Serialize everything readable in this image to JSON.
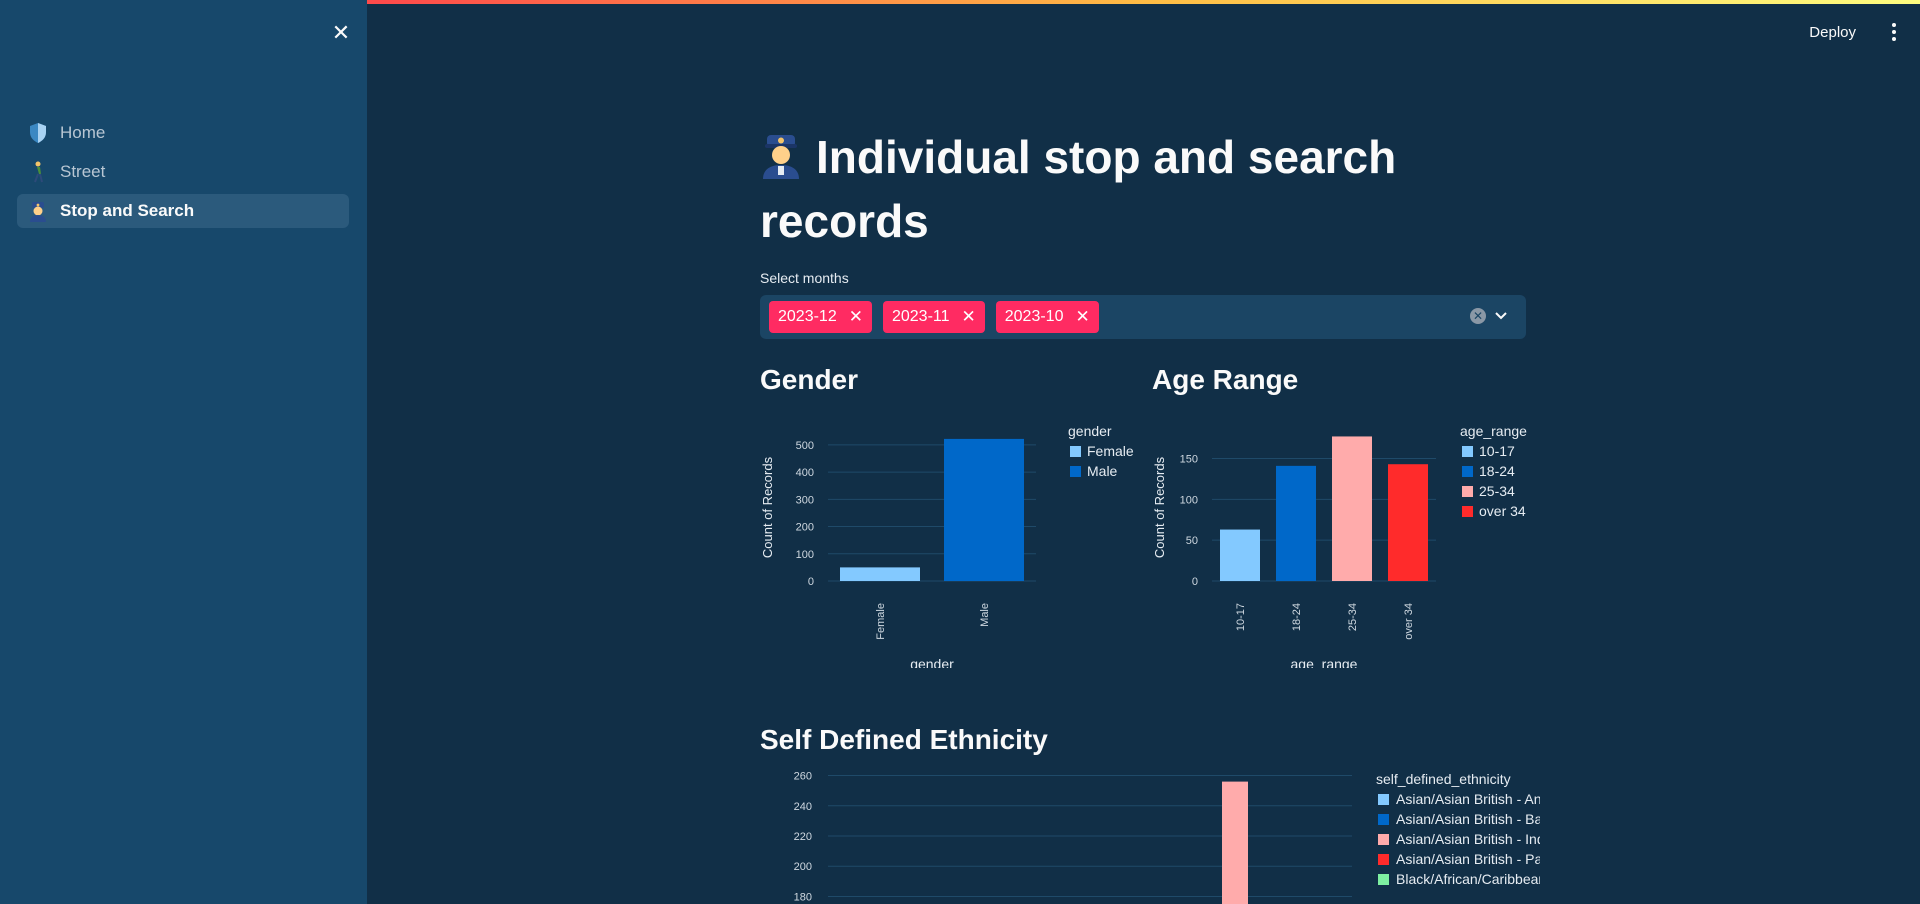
{
  "sidebar": {
    "close_icon": "close-icon",
    "items": [
      {
        "label": "Home",
        "icon": "shield-icon",
        "active": false
      },
      {
        "label": "Street",
        "icon": "walking-person-icon",
        "active": false
      },
      {
        "label": "Stop and Search",
        "icon": "police-officer-icon",
        "active": true
      }
    ]
  },
  "header": {
    "deploy_label": "Deploy",
    "menu_icon": "more-vertical-icon"
  },
  "page": {
    "title": "Individual stop and search records",
    "title_icon": "police-officer-icon"
  },
  "filter": {
    "label": "Select months",
    "chips": [
      {
        "label": "2023-12"
      },
      {
        "label": "2023-11"
      },
      {
        "label": "2023-10"
      }
    ]
  },
  "sections": {
    "gender": "Gender",
    "age": "Age Range",
    "ethnicity": "Self Defined Ethnicity"
  },
  "colors": {
    "accent": "#ff2b62",
    "c1": "#83c9ff",
    "c2": "#0068c9",
    "c3": "#ffabab",
    "c4": "#ff2b2b",
    "c5": "#7defa1"
  },
  "chart_data": [
    {
      "type": "bar",
      "ylabel": "Count of Records",
      "xlabel": "gender",
      "legend_title": "gender",
      "categories": [
        "Female",
        "Male"
      ],
      "values": [
        50,
        522
      ],
      "ylim": [
        0,
        540
      ],
      "yticks": [
        0,
        100,
        200,
        300,
        400,
        500
      ],
      "colors": [
        "#83c9ff",
        "#0068c9"
      ],
      "legend": [
        "Female",
        "Male"
      ]
    },
    {
      "type": "bar",
      "ylabel": "Count of Records",
      "xlabel": "age_range",
      "legend_title": "age_range",
      "categories": [
        "10-17",
        "18-24",
        "25-34",
        "over 34"
      ],
      "values": [
        63,
        141,
        177,
        143
      ],
      "ylim": [
        0,
        180
      ],
      "yticks": [
        0,
        50,
        100,
        150
      ],
      "colors": [
        "#83c9ff",
        "#0068c9",
        "#ffabab",
        "#ff2b2b"
      ],
      "legend": [
        "10-17",
        "18-24",
        "25-34",
        "over 34"
      ]
    },
    {
      "type": "bar",
      "legend_title": "self_defined_ethnicity",
      "yticks": [
        180,
        200,
        220,
        240,
        260
      ],
      "ylim": [
        175,
        265
      ],
      "visible_bar": {
        "color": "#ffabab",
        "value": 256
      },
      "legend": [
        "Asian/Asian British - Any …",
        "Asian/Asian British - Ban…",
        "Asian/Asian British - Indian",
        "Asian/Asian British - Paki…",
        "Black/African/Caribbean…"
      ],
      "colors": [
        "#83c9ff",
        "#0068c9",
        "#ffabab",
        "#ff2b2b",
        "#7defa1"
      ]
    }
  ]
}
